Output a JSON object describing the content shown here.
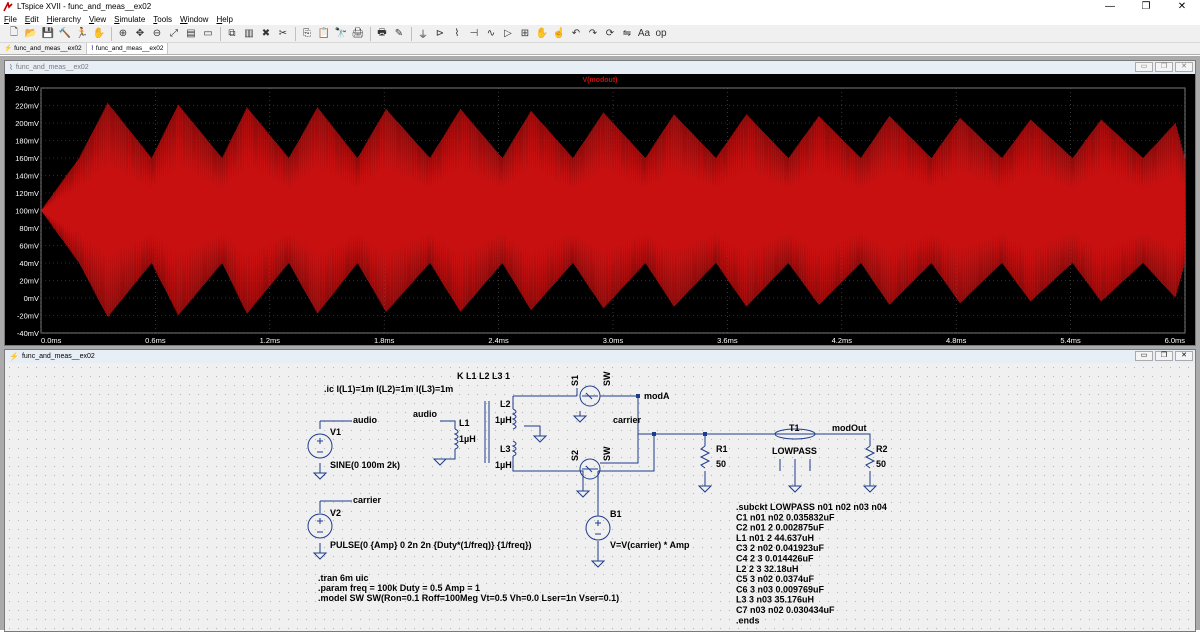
{
  "app": {
    "window_title": "LTspice XVII - func_and_meas__ex02",
    "controls": {
      "minimize": "—",
      "maximize": "❐",
      "close": "✕"
    }
  },
  "menu": [
    {
      "pre": "",
      "key": "F",
      "post": "ile"
    },
    {
      "pre": "",
      "key": "E",
      "post": "dit"
    },
    {
      "pre": "",
      "key": "H",
      "post": "ierarchy"
    },
    {
      "pre": "",
      "key": "V",
      "post": "iew"
    },
    {
      "pre": "",
      "key": "S",
      "post": "imulate"
    },
    {
      "pre": "",
      "key": "T",
      "post": "ools"
    },
    {
      "pre": "",
      "key": "W",
      "post": "indow"
    },
    {
      "pre": "",
      "key": "H",
      "post": "elp"
    }
  ],
  "toolbar": {
    "icons": [
      "new-schematic-icon",
      "open-folder-icon",
      "save-icon",
      "control-panel-icon",
      "run-icon",
      "halt-icon",
      "zoom-in-icon",
      "pan-icon",
      "zoom-out-icon",
      "zoom-fit-icon",
      "autorange-icon",
      "tile-horizontal-icon",
      "cascade-icon",
      "tile-vertical-icon",
      "close-icon",
      "cut-icon",
      "copy-icon",
      "paste-icon",
      "find-icon",
      "print-icon",
      "print-preview-icon",
      "wire-icon",
      "ground-icon",
      "label-icon",
      "resistor-icon",
      "capacitor-icon",
      "inductor-icon",
      "diode-icon",
      "component-icon",
      "move-icon",
      "drag-icon",
      "undo-icon",
      "redo-icon",
      "rotate-icon",
      "mirror-icon",
      "text-icon",
      "spice-directive-icon"
    ],
    "glyphs": [
      "🗋",
      "📂",
      "💾",
      "🔨",
      "🏃",
      "✋",
      "⊕",
      "✥",
      "⊖",
      "⤢",
      "▤",
      "▭",
      "⧉",
      "▥",
      "✖",
      "✂",
      "⎘",
      "📋",
      "🔭",
      "🖨",
      "🖶",
      "✎",
      "⏚",
      "⊳",
      "⌇",
      "⊣",
      "∿",
      "▷",
      "⊞",
      "✋",
      "☝",
      "↶",
      "↷",
      "⟳",
      "⇋",
      "Aa",
      "op"
    ],
    "sep_after": [
      5,
      11,
      15,
      19,
      21
    ]
  },
  "tabs": [
    {
      "label": "func_and_meas__ex02",
      "icon": "schematic-tab-icon",
      "active": false
    },
    {
      "label": "func_and_meas__ex02",
      "icon": "waveform-tab-icon",
      "active": true
    }
  ],
  "plot_pane": {
    "title": "func_and_meas__ex02",
    "trace_label": "V(modout)",
    "trace_color": "#c81010"
  },
  "chart_data": {
    "type": "line",
    "title": "V(modout)",
    "xlabel": "",
    "ylabel": "",
    "x_ticks": [
      "0.0ms",
      "0.6ms",
      "1.2ms",
      "1.8ms",
      "2.4ms",
      "3.0ms",
      "3.6ms",
      "4.2ms",
      "4.8ms",
      "5.4ms",
      "6.0ms"
    ],
    "y_ticks": [
      "240mV",
      "220mV",
      "200mV",
      "180mV",
      "160mV",
      "140mV",
      "120mV",
      "100mV",
      "80mV",
      "60mV",
      "40mV",
      "20mV",
      "0mV",
      "-20mV",
      "-40mV"
    ],
    "xlim": [
      0,
      6.0
    ],
    "ylim": [
      -40,
      240
    ],
    "x_unit": "ms",
    "y_unit": "mV",
    "series": [
      {
        "name": "V(modout)",
        "envelope_x": [
          0.0,
          0.2,
          0.35,
          0.58,
          0.72,
          0.95,
          1.08,
          1.3,
          1.45,
          1.66,
          1.81,
          2.04,
          2.2,
          2.42,
          2.57,
          2.79,
          2.95,
          3.17,
          3.32,
          3.54,
          3.7,
          3.92,
          4.08,
          4.3,
          4.45,
          4.67,
          4.82,
          5.04,
          5.19,
          5.41,
          5.56,
          5.78,
          5.95,
          6.0
        ],
        "envelope_upper": [
          100,
          160,
          223,
          160,
          221,
          160,
          218,
          160,
          218,
          160,
          216,
          160,
          216,
          160,
          214,
          160,
          212,
          160,
          210,
          160,
          210,
          160,
          208,
          160,
          208,
          160,
          206,
          160,
          204,
          160,
          204,
          160,
          200,
          160
        ],
        "envelope_lower": [
          100,
          40,
          -22,
          40,
          -20,
          40,
          -18,
          40,
          -18,
          40,
          -16,
          40,
          -16,
          40,
          -14,
          40,
          -12,
          40,
          -10,
          40,
          -10,
          40,
          -8,
          40,
          -8,
          40,
          -6,
          40,
          -4,
          40,
          -4,
          40,
          0,
          40
        ]
      }
    ],
    "grid": true,
    "background": "#000000"
  },
  "schematic_pane": {
    "title": "func_and_meas__ex02",
    "texts": {
      "k_stmt": "K L1 L2 L3 1",
      "ic_stmt": ".ic I(L1)=1m I(L2)=1m I(L3)=1m",
      "audio1": "audio",
      "audio2": "audio",
      "v1": "V1",
      "v1_val": "SINE(0 100m 2k)",
      "l1": "L1",
      "l1_val": "1µH",
      "l2": "L2",
      "l2_val": "1µH",
      "l3": "L3",
      "l3_val": "1µH",
      "s1": "S1",
      "s1_model": "SW",
      "s2": "S2",
      "s2_model": "SW",
      "moda": "modA",
      "carrier1": "carrier",
      "carrier2": "carrier",
      "r1": "R1",
      "r1_val": "50",
      "t1": "T1",
      "t1_val": "LOWPASS",
      "modout": "modOut",
      "r2": "R2",
      "r2_val": "50",
      "v2": "V2",
      "v2_val": "PULSE(0 {Amp} 0 2n 2n {Duty*(1/freq)} {1/freq})",
      "b1": "B1",
      "b1_val": "V=V(carrier) * Amp",
      "tran": ".tran 6m uic",
      "param": ".param freq = 100k Duty = 0.5 Amp = 1",
      "model": ".model SW SW(Ron=0.1 Roff=100Meg Vt=0.5 Vh=0.0 Lser=1n Vser=0.1)"
    },
    "netlist": [
      ".subckt LOWPASS n01 n02 n03 n04",
      "C1  n01  n02    0.035832uF",
      "C2  n01  2      0.002875uF",
      "L1  n01  2      44.637uH",
      "C3  2    n02    0.041923uF",
      "C4  2    3      0.014426uF",
      "L2  2    3      32.18uH",
      "C5  3    n02    0.0374uF",
      "C6  3    n03    0.009769uF",
      "L3  3    n03    35.176uH",
      "C7  n03  n02    0.030434uF",
      ".ends"
    ]
  }
}
